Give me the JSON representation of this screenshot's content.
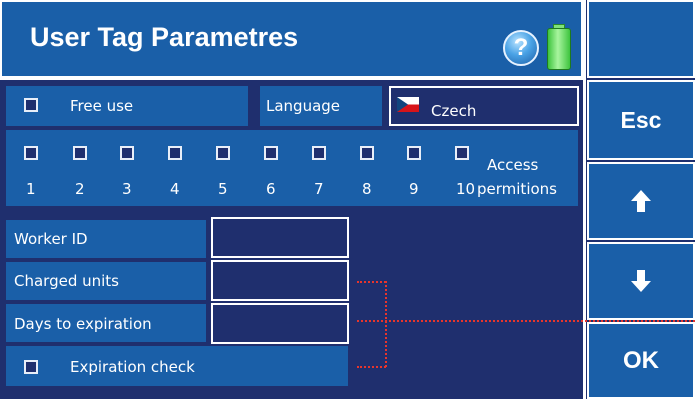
{
  "header": {
    "title": "User Tag Parametres",
    "help_label": "?"
  },
  "side_buttons": {
    "esc": "Esc",
    "ok": "OK"
  },
  "free_use": {
    "label": "Free use",
    "checked": false
  },
  "language": {
    "label": "Language",
    "value": "Czech"
  },
  "permissions": {
    "numbers": [
      "1",
      "2",
      "3",
      "4",
      "5",
      "6",
      "7",
      "8",
      "9",
      "10"
    ],
    "access_label_line1": "Access",
    "access_label_line2": "permitions"
  },
  "fields": {
    "worker_id": {
      "label": "Worker ID",
      "value": ""
    },
    "charged_units": {
      "label": "Charged units",
      "value": ""
    },
    "days_to_expiration": {
      "label": "Days to expiration",
      "value": ""
    }
  },
  "expiration_check": {
    "label": "Expiration check",
    "checked": false
  },
  "colors": {
    "primary": "#1a5fa8",
    "background": "#1f2f6e",
    "accent_line": "#e8352c",
    "border": "#ffffff"
  }
}
